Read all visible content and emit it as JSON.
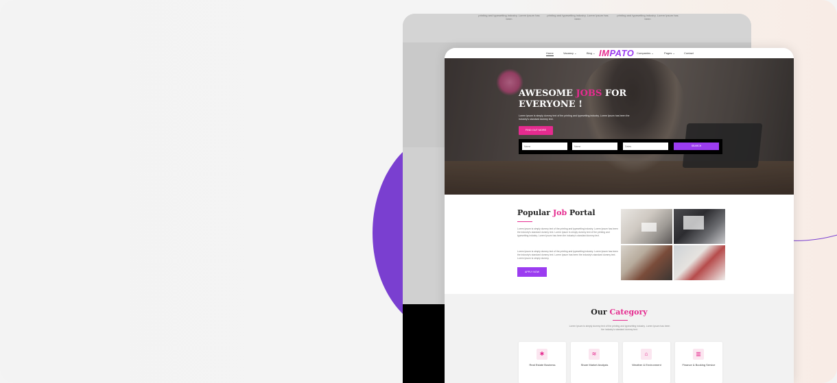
{
  "back_page": {
    "columns": [
      "printing and typesetting industry. Lorem Ipsum has been",
      "printing and typesetting industry. Lorem Ipsum has been",
      "printing and typesetting industry. Lorem Ipsum has been"
    ]
  },
  "nav": {
    "items": [
      "Home",
      "Vacancy ⌄",
      "Blog ⌄",
      "Companies ⌄",
      "Pages ⌄",
      "Contact"
    ],
    "logo_a": "IM",
    "logo_b": "PATO"
  },
  "hero": {
    "title_1": "AWESOME ",
    "title_highlight": "JOBS",
    "title_2": " FOR EVERYONE !",
    "description": "Lorem Ipsum is simply dummy text of the printing and typesetting industry. Lorem Ipsum has been the industry's standard dummy text.",
    "find_button": "FIND OUT MORE",
    "search": {
      "field1_placeholder": "Name",
      "field2_placeholder": "Name",
      "field3_placeholder": "Dates",
      "button": "SEARCH"
    }
  },
  "portal": {
    "title_1": "Popular ",
    "title_highlight": "Job",
    "title_2": " Portal",
    "para1": "Lorem Ipsum is simply dummy text of the printing and typesetting industry. Lorem Ipsum has been the industry's standard dummy text. Lorem Ipsum is simply dummy text of the printing and typesetting industry. Lorem Ipsum has been the industry's standard dummy text.",
    "para2": "Lorem Ipsum is simply dummy text of the printing and typesetting industry. Lorem Ipsum has been the industry's standard dummy text. Lorem Ipsum has been the industry's standard dummy text. Lorem Ipsum is simply dummy.",
    "apply_button": "APPLY NOW"
  },
  "category": {
    "title_1": "Our ",
    "title_highlight": "Category",
    "description": "Lorem Ipsum is simply dummy text of the printing and typesetting industry. Lorem Ipsum has been the industry's standard dummy text.",
    "cards": [
      {
        "icon": "gear-icon",
        "glyph": "✱",
        "label": "Real Estate Business"
      },
      {
        "icon": "layers-icon",
        "glyph": "≋",
        "label": "Share Market Analysis"
      },
      {
        "icon": "home-icon",
        "glyph": "⌂",
        "label": "Weather & Environment"
      },
      {
        "icon": "chart-icon",
        "glyph": "▥",
        "label": "Finance & Booking Service"
      }
    ]
  },
  "colors": {
    "accent_pink": "#e52b8f",
    "accent_purple": "#9b3cf0"
  }
}
